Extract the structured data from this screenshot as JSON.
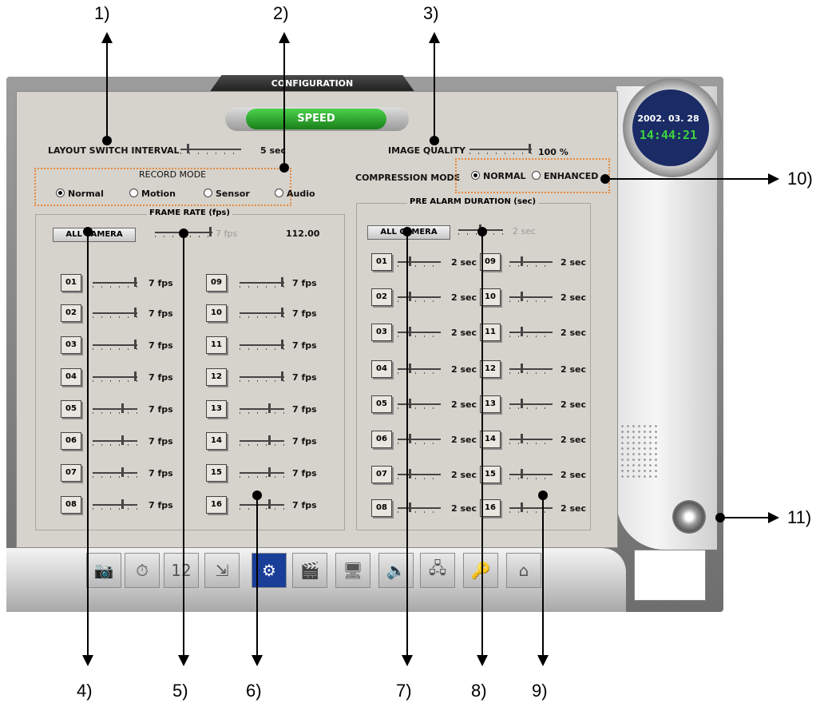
{
  "window": {
    "title": "CONFIGURATION",
    "speed_button": "SPEED"
  },
  "clock": {
    "date": "2002. 03. 28",
    "time": "14:44:21"
  },
  "layout_switch": {
    "label": "LAYOUT SWITCH INTERVAL",
    "value": "5 sec"
  },
  "image_quality": {
    "label": "IMAGE QUALITY",
    "value": "100 %"
  },
  "compression": {
    "label": "COMPRESSION MODE",
    "options": [
      "NORMAL",
      "ENHANCED"
    ],
    "selected": "NORMAL"
  },
  "record_mode": {
    "title": "RECORD MODE",
    "options": [
      "Normal",
      "Motion",
      "Sensor",
      "Audio"
    ],
    "selected": "Normal"
  },
  "frame_rate": {
    "title": "FRAME RATE (fps)",
    "all_camera_label": "ALL CAMERA",
    "all_value": "7 fps",
    "total": "112.00",
    "cameras": [
      {
        "num": "01",
        "value": "7 fps"
      },
      {
        "num": "02",
        "value": "7 fps"
      },
      {
        "num": "03",
        "value": "7 fps"
      },
      {
        "num": "04",
        "value": "7 fps"
      },
      {
        "num": "05",
        "value": "7 fps"
      },
      {
        "num": "06",
        "value": "7 fps"
      },
      {
        "num": "07",
        "value": "7 fps"
      },
      {
        "num": "08",
        "value": "7 fps"
      },
      {
        "num": "09",
        "value": "7 fps"
      },
      {
        "num": "10",
        "value": "7 fps"
      },
      {
        "num": "11",
        "value": "7 fps"
      },
      {
        "num": "12",
        "value": "7 fps"
      },
      {
        "num": "13",
        "value": "7 fps"
      },
      {
        "num": "14",
        "value": "7 fps"
      },
      {
        "num": "15",
        "value": "7 fps"
      },
      {
        "num": "16",
        "value": "7 fps"
      }
    ]
  },
  "pre_alarm": {
    "title": "PRE ALARM DURATION (sec)",
    "all_camera_label": "ALL CAMERA",
    "all_value": "2 sec",
    "cameras": [
      {
        "num": "01",
        "value": "2 sec"
      },
      {
        "num": "02",
        "value": "2 sec"
      },
      {
        "num": "03",
        "value": "2 sec"
      },
      {
        "num": "04",
        "value": "2 sec"
      },
      {
        "num": "05",
        "value": "2 sec"
      },
      {
        "num": "06",
        "value": "2 sec"
      },
      {
        "num": "07",
        "value": "2 sec"
      },
      {
        "num": "08",
        "value": "2 sec"
      },
      {
        "num": "09",
        "value": "2 sec"
      },
      {
        "num": "10",
        "value": "2 sec"
      },
      {
        "num": "11",
        "value": "2 sec"
      },
      {
        "num": "12",
        "value": "2 sec"
      },
      {
        "num": "13",
        "value": "2 sec"
      },
      {
        "num": "14",
        "value": "2 sec"
      },
      {
        "num": "15",
        "value": "2 sec"
      },
      {
        "num": "16",
        "value": "2 sec"
      }
    ]
  },
  "toolbar": [
    "camera-icon",
    "clock-icon",
    "calendar-icon",
    "schedule-icon",
    "speed-config-icon",
    "clapper-icon",
    "monitor-icon",
    "speaker-icon",
    "network-icon",
    "key-icon",
    "home-info-icon"
  ],
  "callouts": [
    "1)",
    "2)",
    "3)",
    "4)",
    "5)",
    "6)",
    "7)",
    "8)",
    "9)",
    "10)",
    "11)"
  ]
}
